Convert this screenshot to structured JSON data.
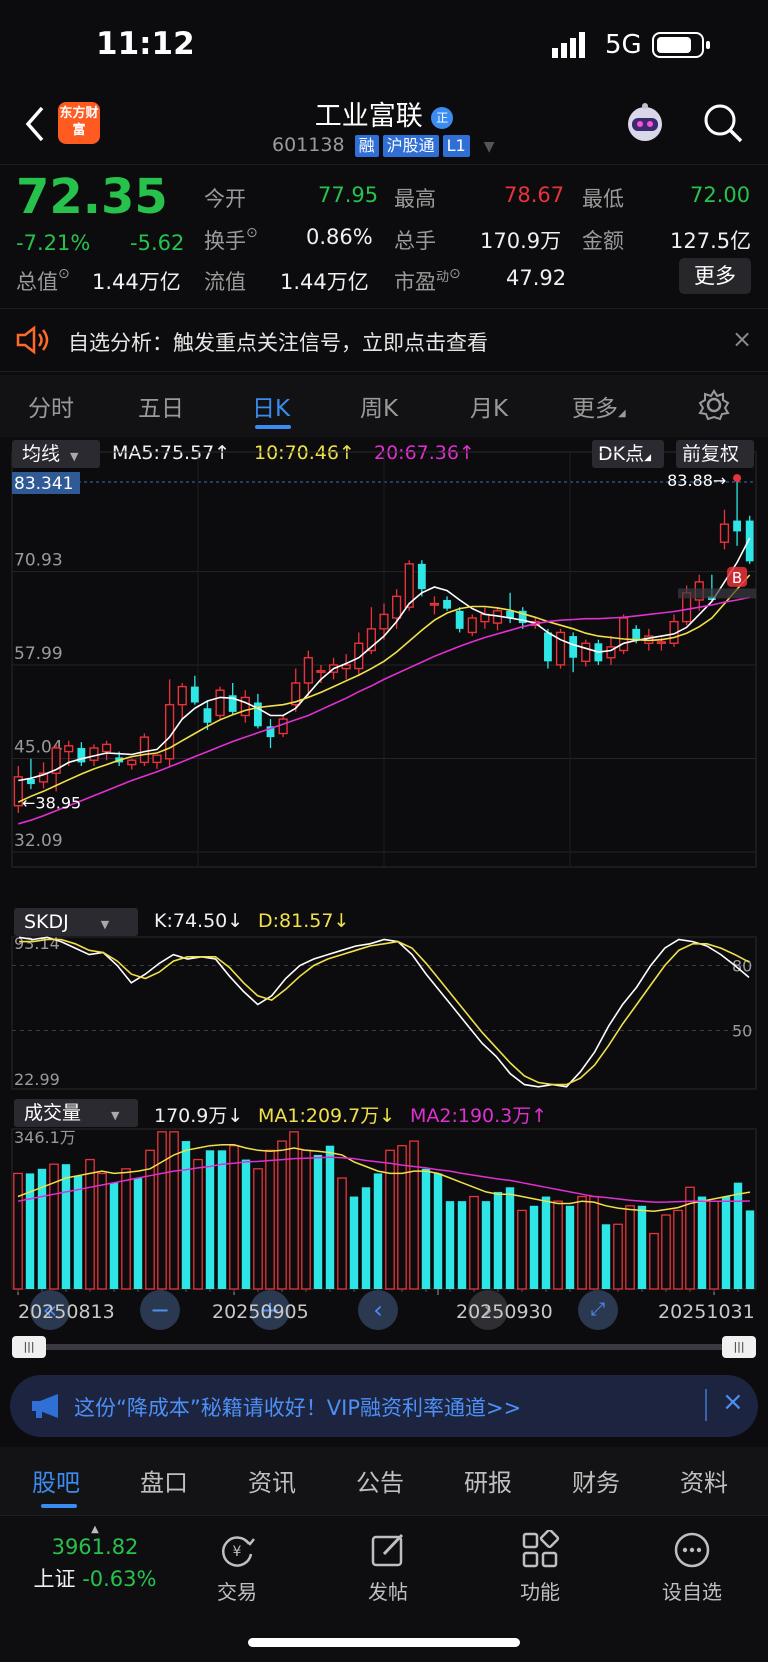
{
  "status_bar": {
    "time": "11:12",
    "network": "5G"
  },
  "header": {
    "title": "工业富联",
    "badge": "正",
    "code": "601138",
    "tags": [
      "融",
      "沪股通",
      "L1"
    ],
    "logo_text": "东方财富"
  },
  "quote": {
    "price": "72.35",
    "change_pct": "-7.21%",
    "change": "-5.62",
    "fields": {
      "open_label": "今开",
      "open": "77.95",
      "high_label": "最高",
      "high": "78.67",
      "low_label": "最低",
      "low": "72.00",
      "turnover_label": "换手",
      "turnover": "0.86%",
      "volume_label": "总手",
      "volume": "170.9万",
      "amount_label": "金额",
      "amount": "127.5亿",
      "mktcap_label": "总值",
      "mktcap": "1.44万亿",
      "float_label": "流值",
      "float": "1.44万亿",
      "pe_label": "市盈",
      "pe_sup": "动",
      "pe": "47.92"
    },
    "more_label": "更多"
  },
  "notice": {
    "text": "自选分析：触发重点关注信号，立即点击查看"
  },
  "period_tabs": [
    "分时",
    "五日",
    "日K",
    "周K",
    "月K",
    "更多"
  ],
  "active_period": "日K",
  "kline": {
    "selector": "均线",
    "ma5": "MA5:75.57",
    "ma10": "10:70.46",
    "ma20": "20:67.36",
    "dk_button": "DK点",
    "adjust_button": "前复权",
    "y_ticks": [
      "83.341",
      "70.93",
      "57.99",
      "45.04",
      "32.09"
    ],
    "high_mark": "83.88",
    "low_mark": "38.95",
    "b_marker": "B"
  },
  "skdj": {
    "selector": "SKDJ",
    "k": "K:74.50",
    "d": "D:81.57",
    "y_ticks": [
      "93.14",
      "80",
      "50",
      "22.99"
    ]
  },
  "volume": {
    "selector": "成交量",
    "value": "170.9万",
    "ma1": "MA1:209.7万",
    "ma2": "MA2:190.3万",
    "y_top": "346.1万",
    "dates": [
      "20250813",
      "20250905",
      "20250930",
      "20251031"
    ]
  },
  "colors": {
    "up": "#e8333a",
    "down": "#2ee6e6",
    "ma5": "#ffffff",
    "ma10": "#f1e04a",
    "ma20": "#e030d0",
    "accent": "#3b8cf0"
  },
  "chart_data": {
    "type": "candlestick",
    "start_date": "20250813",
    "ylim": [
      32.09,
      83.341
    ],
    "candles": [
      {
        "o": 38.5,
        "h": 44.0,
        "l": 37.5,
        "c": 42.5
      },
      {
        "o": 42.2,
        "h": 45.0,
        "l": 40.8,
        "c": 41.5
      },
      {
        "o": 41.8,
        "h": 44.5,
        "l": 40.9,
        "c": 43.0
      },
      {
        "o": 43.0,
        "h": 47.0,
        "l": 40.5,
        "c": 46.5
      },
      {
        "o": 46.0,
        "h": 47.5,
        "l": 44.0,
        "c": 46.8
      },
      {
        "o": 46.5,
        "h": 47.3,
        "l": 44.0,
        "c": 44.5
      },
      {
        "o": 44.8,
        "h": 47.0,
        "l": 44.0,
        "c": 46.5
      },
      {
        "o": 46.0,
        "h": 47.5,
        "l": 44.8,
        "c": 47.0
      },
      {
        "o": 45.2,
        "h": 46.0,
        "l": 44.0,
        "c": 44.5
      },
      {
        "o": 44.2,
        "h": 45.0,
        "l": 43.5,
        "c": 44.8
      },
      {
        "o": 44.5,
        "h": 48.5,
        "l": 44.0,
        "c": 48.0
      },
      {
        "o": 44.5,
        "h": 45.5,
        "l": 43.6,
        "c": 45.5
      },
      {
        "o": 45.0,
        "h": 56.0,
        "l": 43.8,
        "c": 52.5
      },
      {
        "o": 52.5,
        "h": 55.5,
        "l": 50.5,
        "c": 55.0
      },
      {
        "o": 55.0,
        "h": 56.5,
        "l": 52.5,
        "c": 52.8
      },
      {
        "o": 52.0,
        "h": 53.0,
        "l": 49.0,
        "c": 50.0
      },
      {
        "o": 51.0,
        "h": 55.0,
        "l": 50.5,
        "c": 54.5
      },
      {
        "o": 53.8,
        "h": 55.5,
        "l": 51.0,
        "c": 51.5
      },
      {
        "o": 51.0,
        "h": 54.5,
        "l": 50.0,
        "c": 53.5
      },
      {
        "o": 52.8,
        "h": 54.0,
        "l": 49.2,
        "c": 49.5
      },
      {
        "o": 49.5,
        "h": 50.5,
        "l": 46.5,
        "c": 48.0
      },
      {
        "o": 48.5,
        "h": 51.0,
        "l": 48.0,
        "c": 50.5
      },
      {
        "o": 52.5,
        "h": 57.5,
        "l": 51.5,
        "c": 55.5
      },
      {
        "o": 55.5,
        "h": 60.0,
        "l": 53.5,
        "c": 59.0
      },
      {
        "o": 57.0,
        "h": 58.0,
        "l": 55.5,
        "c": 57.2
      },
      {
        "o": 57.0,
        "h": 59.0,
        "l": 56.0,
        "c": 58.0
      },
      {
        "o": 57.5,
        "h": 59.5,
        "l": 56.0,
        "c": 58.0
      },
      {
        "o": 57.5,
        "h": 62.5,
        "l": 56.5,
        "c": 61.0
      },
      {
        "o": 60.0,
        "h": 66.0,
        "l": 59.5,
        "c": 63.0
      },
      {
        "o": 63.0,
        "h": 66.5,
        "l": 61.5,
        "c": 65.0
      },
      {
        "o": 64.5,
        "h": 68.5,
        "l": 63.0,
        "c": 67.5
      },
      {
        "o": 66.0,
        "h": 72.5,
        "l": 65.5,
        "c": 72.0
      },
      {
        "o": 72.0,
        "h": 72.5,
        "l": 67.5,
        "c": 68.5
      },
      {
        "o": 66.5,
        "h": 67.5,
        "l": 65.0,
        "c": 66.5
      },
      {
        "o": 67.0,
        "h": 67.5,
        "l": 65.5,
        "c": 65.8
      },
      {
        "o": 65.5,
        "h": 66.0,
        "l": 62.5,
        "c": 63.0
      },
      {
        "o": 62.5,
        "h": 65.0,
        "l": 62.0,
        "c": 64.5
      },
      {
        "o": 64.0,
        "h": 66.0,
        "l": 63.0,
        "c": 65.0
      },
      {
        "o": 63.8,
        "h": 66.0,
        "l": 62.8,
        "c": 65.5
      },
      {
        "o": 65.5,
        "h": 68.0,
        "l": 63.8,
        "c": 64.5
      },
      {
        "o": 65.5,
        "h": 66.0,
        "l": 63.0,
        "c": 63.8
      },
      {
        "o": 63.5,
        "h": 64.5,
        "l": 63.0,
        "c": 64.0
      },
      {
        "o": 62.5,
        "h": 63.0,
        "l": 57.5,
        "c": 58.5
      },
      {
        "o": 58.0,
        "h": 63.0,
        "l": 57.5,
        "c": 62.5
      },
      {
        "o": 62.0,
        "h": 62.5,
        "l": 57.0,
        "c": 59.0
      },
      {
        "o": 58.5,
        "h": 61.5,
        "l": 57.8,
        "c": 61.0
      },
      {
        "o": 61.0,
        "h": 61.5,
        "l": 58.0,
        "c": 58.5
      },
      {
        "o": 59.0,
        "h": 62.0,
        "l": 58.0,
        "c": 60.5
      },
      {
        "o": 60.0,
        "h": 65.0,
        "l": 59.5,
        "c": 64.5
      },
      {
        "o": 63.0,
        "h": 63.5,
        "l": 61.0,
        "c": 61.5
      },
      {
        "o": 61.0,
        "h": 63.0,
        "l": 60.0,
        "c": 62.0
      },
      {
        "o": 61.0,
        "h": 61.8,
        "l": 60.0,
        "c": 61.2
      },
      {
        "o": 61.0,
        "h": 65.0,
        "l": 60.5,
        "c": 64.0
      },
      {
        "o": 64.0,
        "h": 69.0,
        "l": 63.5,
        "c": 68.0
      },
      {
        "o": 67.0,
        "h": 70.5,
        "l": 65.5,
        "c": 69.5
      },
      {
        "o": 67.5,
        "h": 70.5,
        "l": 66.8,
        "c": 67.0
      },
      {
        "o": 75.0,
        "h": 79.5,
        "l": 74.0,
        "c": 77.5
      },
      {
        "o": 78.0,
        "h": 83.88,
        "l": 74.5,
        "c": 76.5
      },
      {
        "o": 78.0,
        "h": 78.67,
        "l": 72.0,
        "c": 72.35
      }
    ],
    "ma5": [
      42,
      42.3,
      42.8,
      43.5,
      44.5,
      45,
      45.4,
      45.8,
      45.7,
      45.6,
      46,
      46.3,
      48,
      50.5,
      52,
      53,
      53.5,
      53.4,
      52.8,
      52,
      51,
      51,
      52,
      54,
      56,
      57.5,
      58.2,
      59,
      60.5,
      62,
      64,
      66.5,
      68,
      68.8,
      68.3,
      67,
      65.8,
      65,
      64.8,
      64.5,
      64.2,
      63.8,
      62.5,
      61.5,
      60.8,
      60.3,
      59.8,
      60,
      61,
      61.4,
      61.7,
      62,
      62.3,
      63.2,
      65,
      66.8,
      69.5,
      72.2,
      75.57
    ],
    "ma10": [
      39,
      39.8,
      40.5,
      41.3,
      42.1,
      42.9,
      43.6,
      44.2,
      44.8,
      45.3,
      45.6,
      45.8,
      46.5,
      47.5,
      48.5,
      49.5,
      50.4,
      51.1,
      51.7,
      52.1,
      52.3,
      52.5,
      52.9,
      53.5,
      54.2,
      55,
      55.8,
      56.6,
      57.5,
      58.5,
      59.8,
      61.3,
      62.8,
      64.2,
      65.2,
      65.8,
      66.1,
      66.1,
      65.9,
      65.6,
      65.1,
      64.6,
      64,
      63.5,
      63,
      62.4,
      62,
      61.8,
      61.6,
      61.5,
      61.4,
      61.5,
      61.8,
      62.4,
      63.3,
      64.5,
      66.5,
      68.5,
      70.46
    ],
    "ma20": [
      36,
      36.5,
      37.1,
      37.8,
      38.5,
      39.2,
      39.9,
      40.6,
      41.3,
      42,
      42.6,
      43.2,
      43.9,
      44.6,
      45.3,
      46,
      46.7,
      47.4,
      48,
      48.6,
      49.2,
      49.8,
      50.4,
      51,
      51.8,
      52.6,
      53.4,
      54.3,
      55.1,
      56,
      56.8,
      57.6,
      58.4,
      59.2,
      59.9,
      60.6,
      61.2,
      61.8,
      62.3,
      62.8,
      63.3,
      63.7,
      64,
      64.2,
      64.3,
      64.4,
      64.4,
      64.5,
      64.6,
      64.8,
      65,
      65.2,
      65.4,
      65.7,
      66,
      66.3,
      66.7,
      67,
      67.36
    ],
    "skdj": {
      "ylim": [
        22.99,
        93.14
      ],
      "k": [
        93,
        92,
        93,
        91,
        88,
        85,
        86,
        80,
        72,
        76,
        81,
        85,
        83,
        84,
        83,
        75,
        68,
        62,
        66,
        74,
        80,
        83,
        85,
        87,
        89,
        90,
        92,
        91,
        85,
        76,
        68,
        60,
        52,
        44,
        38,
        30,
        25,
        24,
        25,
        24,
        31,
        40,
        52,
        62,
        70,
        80,
        88,
        92,
        91,
        89,
        85,
        80,
        74.5
      ],
      "d": [
        91,
        91,
        92,
        92,
        90,
        87,
        86,
        82,
        76,
        74,
        77,
        82,
        84,
        84,
        84,
        79,
        72,
        66,
        64,
        69,
        75,
        80,
        83,
        85,
        87,
        89,
        90,
        91,
        88,
        81,
        73,
        65,
        57,
        49,
        42,
        35,
        29,
        26,
        25,
        25,
        28,
        34,
        43,
        53,
        62,
        71,
        80,
        87,
        90,
        90,
        88,
        85,
        81.57
      ]
    },
    "volume": {
      "ylim": [
        0,
        346.1
      ],
      "values": [
        250,
        250,
        260,
        270,
        270,
        245,
        280,
        250,
        230,
        260,
        240,
        300,
        340,
        340,
        320,
        280,
        300,
        300,
        310,
        280,
        260,
        300,
        320,
        340,
        300,
        290,
        310,
        240,
        200,
        220,
        250,
        300,
        310,
        320,
        260,
        250,
        190,
        190,
        200,
        190,
        210,
        220,
        170,
        180,
        200,
        190,
        180,
        200,
        200,
        140,
        140,
        180,
        180,
        120,
        160,
        170,
        220,
        200,
        190,
        200,
        230,
        170
      ],
      "up_down": [
        "u",
        "d",
        "d",
        "u",
        "d",
        "d",
        "u",
        "u",
        "d",
        "u",
        "d",
        "u",
        "u",
        "u",
        "d",
        "u",
        "d",
        "d",
        "u",
        "d",
        "u",
        "u",
        "u",
        "u",
        "u",
        "d",
        "d",
        "u",
        "d",
        "d",
        "d",
        "u",
        "u",
        "u",
        "d",
        "d",
        "d",
        "d",
        "u",
        "d",
        "d",
        "d",
        "u",
        "d",
        "d",
        "u",
        "d",
        "u",
        "u",
        "d",
        "u",
        "u",
        "d",
        "u",
        "u",
        "u",
        "u",
        "d",
        "u",
        "d",
        "d",
        "d"
      ],
      "ma1": [
        200,
        210,
        220,
        230,
        240,
        245,
        250,
        255,
        250,
        252,
        255,
        260,
        275,
        290,
        300,
        305,
        310,
        312,
        312,
        305,
        300,
        298,
        300,
        305,
        300,
        298,
        295,
        290,
        275,
        265,
        255,
        250,
        250,
        255,
        255,
        250,
        240,
        230,
        220,
        210,
        205,
        205,
        200,
        195,
        190,
        185,
        185,
        190,
        188,
        180,
        175,
        172,
        170,
        168,
        172,
        176,
        185,
        190,
        195,
        200,
        205,
        209.7
      ],
      "ma2": [
        190,
        195,
        200,
        205,
        210,
        215,
        220,
        225,
        230,
        235,
        240,
        245,
        250,
        255,
        258,
        262,
        265,
        270,
        272,
        275,
        276,
        278,
        280,
        282,
        283,
        284,
        285,
        284,
        282,
        278,
        275,
        272,
        268,
        265,
        262,
        258,
        255,
        250,
        246,
        242,
        238,
        235,
        230,
        225,
        220,
        215,
        210,
        205,
        200,
        198,
        195,
        192,
        190,
        188,
        188,
        189,
        190,
        190,
        190,
        190,
        190,
        190.3
      ]
    }
  },
  "banner": {
    "text": "这份“降成本”秘籍请收好！VIP融资利率通道>>"
  },
  "bottom_tabs": [
    "股吧",
    "盘口",
    "资讯",
    "公告",
    "研报",
    "财务",
    "资料"
  ],
  "active_bottom_tab": "股吧",
  "toolbar": {
    "index_value": "3961.82",
    "index_name": "上证",
    "index_change": "-0.63%",
    "items": [
      "交易",
      "发帖",
      "功能",
      "设自选"
    ]
  }
}
